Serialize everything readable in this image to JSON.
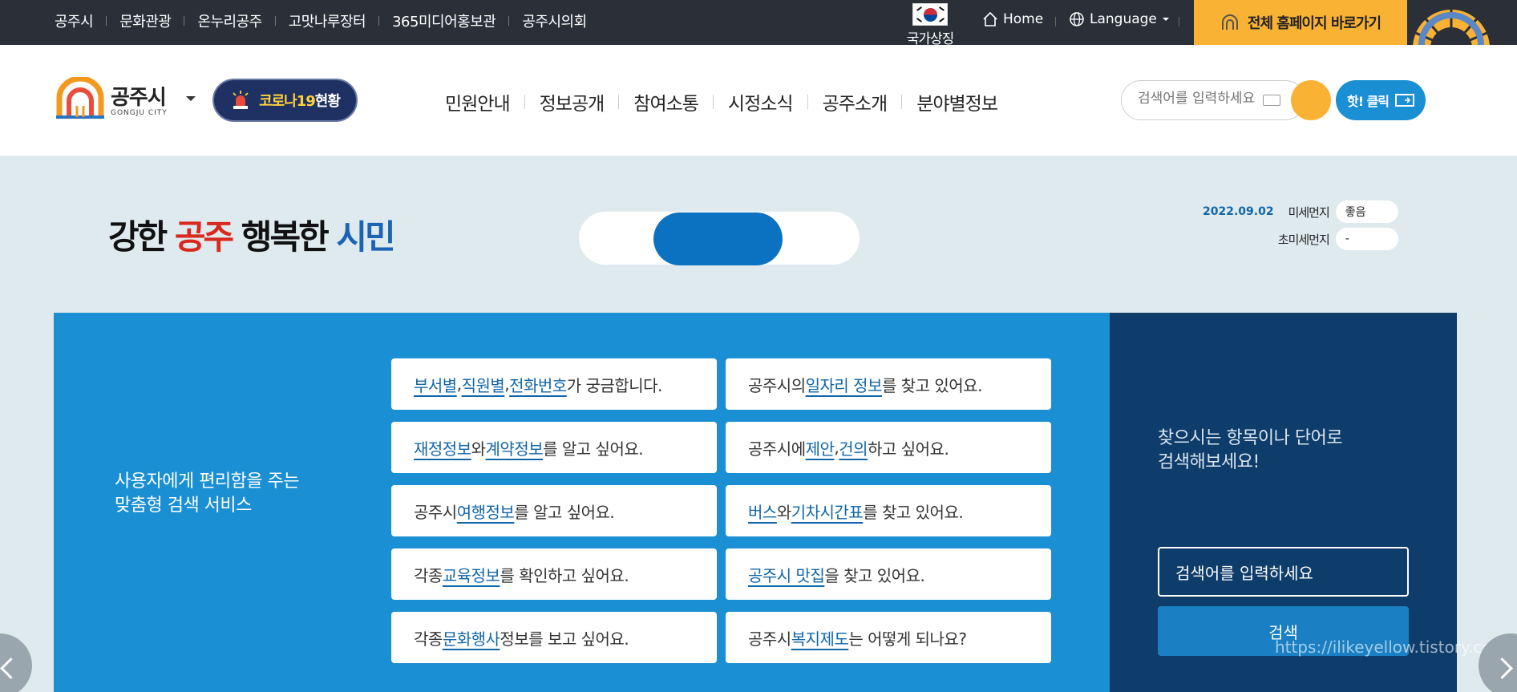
{
  "topbar": {
    "links": [
      "공주시",
      "문화관광",
      "온누리공주",
      "고맛나루장터",
      "365미디어홍보관",
      "공주시의회"
    ],
    "flag_label": "국가상징",
    "home_label": "Home",
    "language_label": "Language",
    "fullsite_label": "전체 홈페이지 바로가기"
  },
  "header": {
    "logo_ko": "공주시",
    "logo_en": "GONGJU CITY",
    "covid_prefix": "코로나19",
    "covid_suffix": "현황",
    "nav": [
      "민원안내",
      "정보공개",
      "참여소통",
      "시정소식",
      "공주소개",
      "분야별정보"
    ],
    "search_placeholder": "검색어를 입력하세요",
    "hotclick_label": "핫! 클릭"
  },
  "visual": {
    "slogan_parts": [
      "강한 ",
      "공주",
      " 행복한 ",
      "시민"
    ],
    "air": {
      "date": "2022.09.02",
      "pm10_label": "미세먼지",
      "pm10_value": "좋음",
      "pm25_label": "초미세먼지",
      "pm25_value": "-"
    }
  },
  "service": {
    "title_line1": "사용자에게 편리함을 주는",
    "title_line2": "맞춤형 검색 서비스",
    "queries": [
      {
        "parts": [
          [
            "부서별",
            true
          ],
          [
            ", ",
            false
          ],
          [
            "직원별",
            true
          ],
          [
            ", ",
            false
          ],
          [
            "전화번호",
            true
          ],
          [
            "가 궁금합니다.",
            false
          ]
        ]
      },
      {
        "parts": [
          [
            "공주시의 ",
            false
          ],
          [
            "일자리 정보",
            true
          ],
          [
            "를 찾고 있어요.",
            false
          ]
        ]
      },
      {
        "parts": [
          [
            "재정정보",
            true
          ],
          [
            "와 ",
            false
          ],
          [
            "계약정보",
            true
          ],
          [
            "를 알고 싶어요.",
            false
          ]
        ]
      },
      {
        "parts": [
          [
            "공주시에 ",
            false
          ],
          [
            "제안",
            true
          ],
          [
            ", ",
            false
          ],
          [
            "건의",
            true
          ],
          [
            "하고 싶어요.",
            false
          ]
        ]
      },
      {
        "parts": [
          [
            "공주시 ",
            false
          ],
          [
            "여행정보",
            true
          ],
          [
            "를 알고 싶어요.",
            false
          ]
        ]
      },
      {
        "parts": [
          [
            "버스",
            true
          ],
          [
            "와 ",
            false
          ],
          [
            "기차",
            true
          ],
          [
            " ",
            false
          ],
          [
            "시간표",
            true
          ],
          [
            "를 찾고 있어요.",
            false
          ]
        ]
      },
      {
        "parts": [
          [
            "각종 ",
            false
          ],
          [
            "교육정보",
            true
          ],
          [
            "를 확인하고 싶어요.",
            false
          ]
        ]
      },
      {
        "parts": [
          [
            "공주시 맛집",
            true
          ],
          [
            "을 찾고 있어요.",
            false
          ]
        ]
      },
      {
        "parts": [
          [
            "각종 ",
            false
          ],
          [
            "문화행사",
            true
          ],
          [
            " 정보를 보고 싶어요.",
            false
          ]
        ]
      },
      {
        "parts": [
          [
            "공주시 ",
            false
          ],
          [
            "복지제도",
            true
          ],
          [
            "는 어떻게 되나요?",
            false
          ]
        ]
      }
    ],
    "right_title_line1": "찾으시는 항목이나 단어로",
    "right_title_line2": "검색해보세요!",
    "right_placeholder": "검색어를 입력하세요",
    "right_button": "검색",
    "watermark": "https://ilikeyellow.tistory.com"
  },
  "colors": {
    "topbar": "#2b3038",
    "accent_yellow": "#f9b233",
    "panel_blue": "#1a8fd3",
    "panel_navy": "#0e3c6b",
    "link_blue": "#1166a8"
  }
}
